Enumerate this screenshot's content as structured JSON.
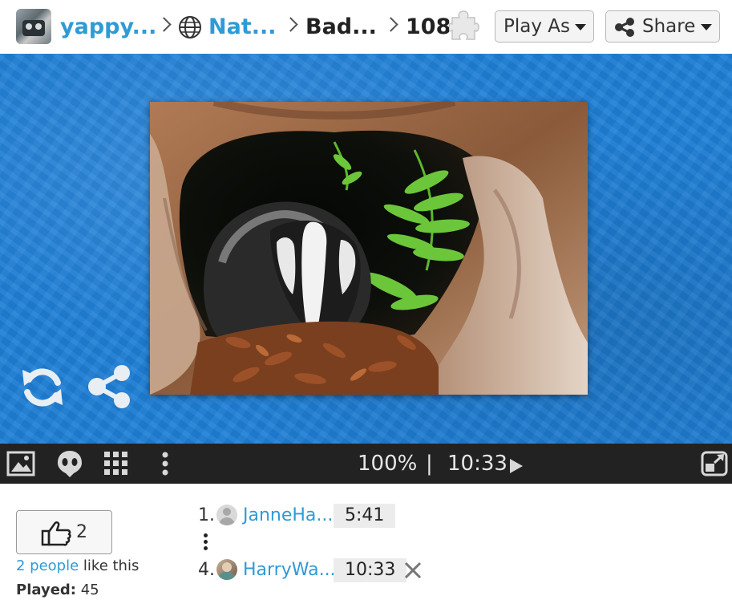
{
  "header": {
    "user": "yappy...",
    "category": "Nat...",
    "puzzle_title": "Bad...",
    "piece_count": "108",
    "play_as_label": "Play As",
    "share_label": "Share"
  },
  "toolbar": {
    "zoom": "100%",
    "separator": "|",
    "timer": "10:33"
  },
  "likes": {
    "count": "2",
    "link_text": "2 people",
    "suffix": " like this"
  },
  "stats": {
    "played_label": "Played:",
    "played_value": "45"
  },
  "leaderboard": [
    {
      "rank": "1.",
      "name": "JanneHa...",
      "time": "5:41"
    },
    {
      "rank": "4.",
      "name": "HarryWa...",
      "time": "10:33"
    }
  ],
  "colors": {
    "accent": "#2e9bd6",
    "stage": "#1f7fd6",
    "toolbar": "#222222"
  },
  "icons": [
    "globe-icon",
    "puzzle-piece-icon",
    "share-icon",
    "refresh-icon",
    "image-icon",
    "ghost-icon",
    "grid-icon",
    "more-vertical-icon",
    "play-icon",
    "fullscreen-icon",
    "thumbs-up-icon",
    "close-icon"
  ]
}
